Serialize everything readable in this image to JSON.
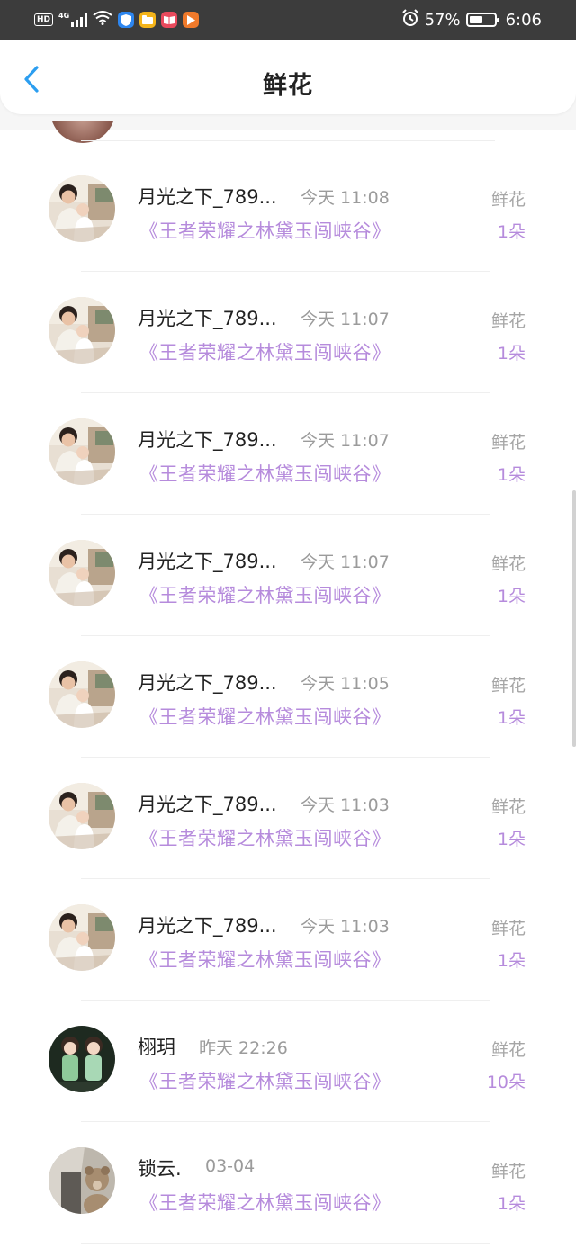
{
  "status_bar": {
    "hd": "HD",
    "network": "4G",
    "battery_percent": "57%",
    "battery_level": 0.57,
    "time": "6:06",
    "icons": [
      "signal-icon",
      "wifi-icon",
      "shield-app-icon",
      "folder-app-icon",
      "book-app-icon",
      "video-app-icon",
      "alarm-icon",
      "battery-icon"
    ]
  },
  "header": {
    "title": "鲜花",
    "back_icon": "chevron-left-icon"
  },
  "colors": {
    "accent_purple": "#b68bdc",
    "back_blue": "#2c9ef0",
    "muted_gray": "#9b9b9b"
  },
  "rows": [
    {
      "name": "月光之下_789...",
      "time": "今天 11:08",
      "work": "《王者荣耀之林黛玉闯峡谷》",
      "gift": "鲜花",
      "count": "1朵",
      "avatar": "family-photo"
    },
    {
      "name": "月光之下_789...",
      "time": "今天 11:07",
      "work": "《王者荣耀之林黛玉闯峡谷》",
      "gift": "鲜花",
      "count": "1朵",
      "avatar": "family-photo"
    },
    {
      "name": "月光之下_789...",
      "time": "今天 11:07",
      "work": "《王者荣耀之林黛玉闯峡谷》",
      "gift": "鲜花",
      "count": "1朵",
      "avatar": "family-photo"
    },
    {
      "name": "月光之下_789...",
      "time": "今天 11:07",
      "work": "《王者荣耀之林黛玉闯峡谷》",
      "gift": "鲜花",
      "count": "1朵",
      "avatar": "family-photo"
    },
    {
      "name": "月光之下_789...",
      "time": "今天 11:05",
      "work": "《王者荣耀之林黛玉闯峡谷》",
      "gift": "鲜花",
      "count": "1朵",
      "avatar": "family-photo"
    },
    {
      "name": "月光之下_789...",
      "time": "今天 11:03",
      "work": "《王者荣耀之林黛玉闯峡谷》",
      "gift": "鲜花",
      "count": "1朵",
      "avatar": "family-photo"
    },
    {
      "name": "月光之下_789...",
      "time": "今天 11:03",
      "work": "《王者荣耀之林黛玉闯峡谷》",
      "gift": "鲜花",
      "count": "1朵",
      "avatar": "family-photo"
    },
    {
      "name": "栩玥",
      "time": "昨天 22:26",
      "work": "《王者荣耀之林黛玉闯峡谷》",
      "gift": "鲜花",
      "count": "10朵",
      "avatar": "cartoon-pair"
    },
    {
      "name": "锁云.",
      "time": "03-04",
      "work": "《王者荣耀之林黛玉闯峡谷》",
      "gift": "鲜花",
      "count": "1朵",
      "avatar": "bear-photo"
    }
  ]
}
